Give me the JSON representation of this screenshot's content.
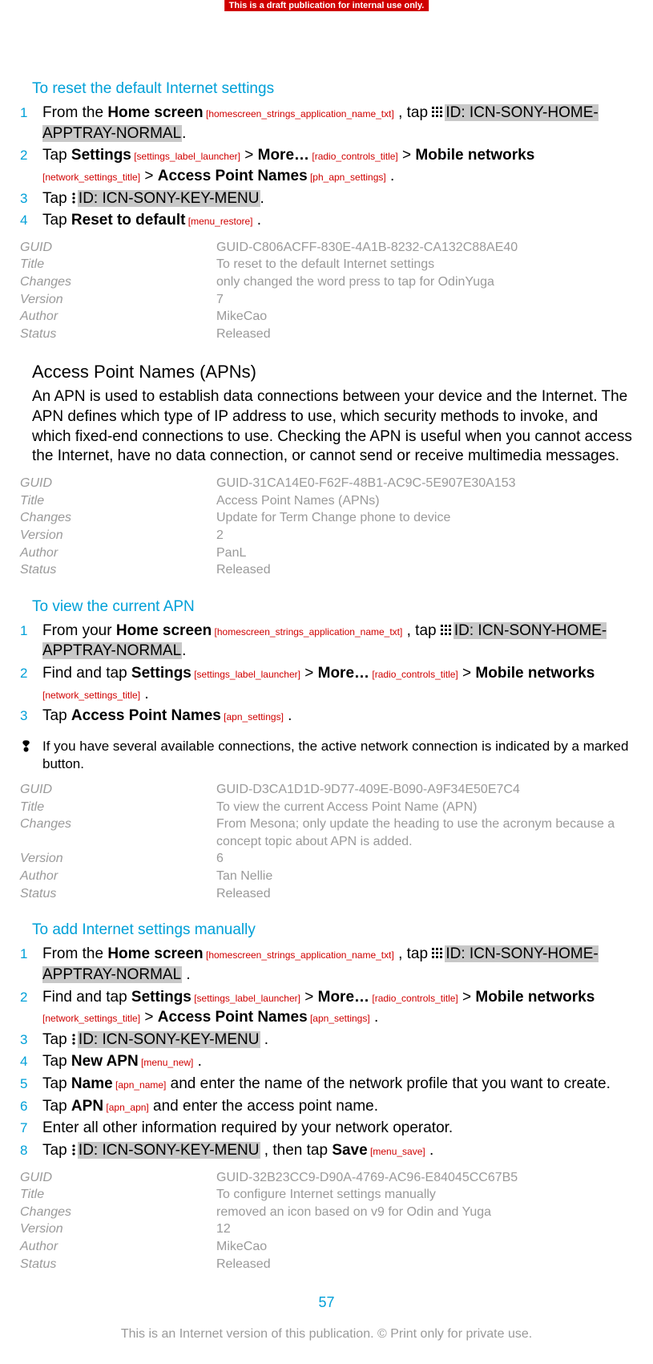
{
  "banner": "This is a draft publication for internal use only.",
  "s1": {
    "title": "To reset the default Internet settings",
    "steps": [
      {
        "pre": "From the ",
        "b1": "Home screen",
        "ref1": " [homescreen_strings_application_name_txt]",
        "mid": " , tap ",
        "icon": "grid",
        "hl": "ID: ICN-SONY-HOME-APPTRAY-NORMAL",
        "post": "."
      },
      {
        "pre": "Tap ",
        "b1": "Settings",
        "ref1": " [settings_label_launcher]",
        "mid": " > ",
        "b2": "More…",
        "ref2": " [radio_controls_title]",
        "mid2": " > ",
        "b3": "Mobile networks",
        "ref3": " [network_settings_title]",
        "mid3": " > ",
        "b4": "Access Point Names",
        "ref4": " [ph_apn_settings]",
        "post": " ."
      },
      {
        "pre": "Tap ",
        "icon": "menu",
        "hl": "ID: ICN-SONY-KEY-MENU",
        "post": "."
      },
      {
        "pre": "Tap ",
        "b1": "Reset to default",
        "ref1": " [menu_restore]",
        "post": " ."
      }
    ],
    "meta": {
      "GUID": "GUID-C806ACFF-830E-4A1B-8232-CA132C88AE40",
      "Title": "To reset to the default Internet settings",
      "Changes": "only changed the word press to tap for OdinYuga",
      "Version": "7",
      "Author": "MikeCao",
      "Status": "Released"
    }
  },
  "s2": {
    "title": "Access Point Names (APNs)",
    "body": "An APN is used to establish data connections between your device and the Internet. The APN defines which type of IP address to use, which security methods to invoke, and which fixed-end connections to use. Checking the APN is useful when you cannot access the Internet, have no data connection, or cannot send or receive multimedia messages.",
    "meta": {
      "GUID": "GUID-31CA14E0-F62F-48B1-AC9C-5E907E30A153",
      "Title": "Access Point Names (APNs)",
      "Changes": "Update for Term Change phone to device",
      "Version": "2",
      "Author": "PanL",
      "Status": "Released"
    }
  },
  "s3": {
    "title": "To view the current APN",
    "steps": [
      {
        "pre": "From your ",
        "b1": "Home screen",
        "ref1": " [homescreen_strings_application_name_txt]",
        "mid": " , tap ",
        "icon": "grid",
        "hl": "ID: ICN-SONY-HOME-APPTRAY-NORMAL",
        "post": "."
      },
      {
        "pre": "Find and tap ",
        "b1": "Settings",
        "ref1": " [settings_label_launcher]",
        "mid": " > ",
        "b2": "More…",
        "ref2": " [radio_controls_title]",
        "mid2": " > ",
        "b3": "Mobile networks",
        "ref3": " [network_settings_title]",
        "post": " ."
      },
      {
        "pre": "Tap ",
        "b1": "Access Point Names",
        "ref1": " [apn_settings]",
        "post": " ."
      }
    ],
    "note": "If you have several available connections, the active network connection is indicated by a marked button.",
    "meta": {
      "GUID": "GUID-D3CA1D1D-9D77-409E-B090-A9F34E50E7C4",
      "Title": "To view the current Access Point Name (APN)",
      "Changes": "From Mesona; only update the heading to use the acronym because a concept topic about APN is added.",
      "Version": "6",
      "Author": "Tan Nellie",
      "Status": "Released"
    }
  },
  "s4": {
    "title": "To add Internet settings manually",
    "steps": [
      {
        "pre": "From the ",
        "b1": "Home screen",
        "ref1": " [homescreen_strings_application_name_txt]",
        "mid": " , tap ",
        "icon": "grid",
        "hl": "ID: ICN-SONY-HOME-APPTRAY-NORMAL",
        "post": " ."
      },
      {
        "pre": "Find and tap ",
        "b1": "Settings",
        "ref1": " [settings_label_launcher]",
        "mid": " > ",
        "b2": "More…",
        "ref2": " [radio_controls_title]",
        "mid2": " > ",
        "b3": "Mobile networks",
        "ref3": " [network_settings_title]",
        "mid3": " > ",
        "b4": "Access Point Names",
        "ref4": " [apn_settings]",
        "post": " ."
      },
      {
        "pre": "Tap ",
        "icon": "menu",
        "hl": "ID: ICN-SONY-KEY-MENU",
        "post": " ."
      },
      {
        "pre": "Tap ",
        "b1": "New APN",
        "ref1": " [menu_new]",
        "post": " ."
      },
      {
        "pre": "Tap ",
        "b1": "Name",
        "ref1": " [apn_name]",
        "post": " and enter the name of the network profile that you want to create."
      },
      {
        "pre": "Tap ",
        "b1": "APN",
        "ref1": " [apn_apn]",
        "post": " and enter the access point name."
      },
      {
        "plain": "Enter all other information required by your network operator."
      },
      {
        "pre": "Tap ",
        "icon": "menu",
        "hl": "ID: ICN-SONY-KEY-MENU",
        "post": " , then tap ",
        "b1": "Save",
        "ref1": " [menu_save]",
        "post2": " ."
      }
    ],
    "meta": {
      "GUID": "GUID-32B23CC9-D90A-4769-AC96-E84045CC67B5",
      "Title": "To configure Internet settings manually",
      "Changes": "removed an icon based on v9 for Odin and Yuga",
      "Version": "12",
      "Author": "MikeCao",
      "Status": "Released"
    }
  },
  "pageNumber": "57",
  "footerNote": "This is an Internet version of this publication. © Print only for private use.",
  "metaLabels": {
    "guid": "GUID",
    "title": "Title",
    "changes": "Changes",
    "version": "Version",
    "author": "Author",
    "status": "Status"
  }
}
